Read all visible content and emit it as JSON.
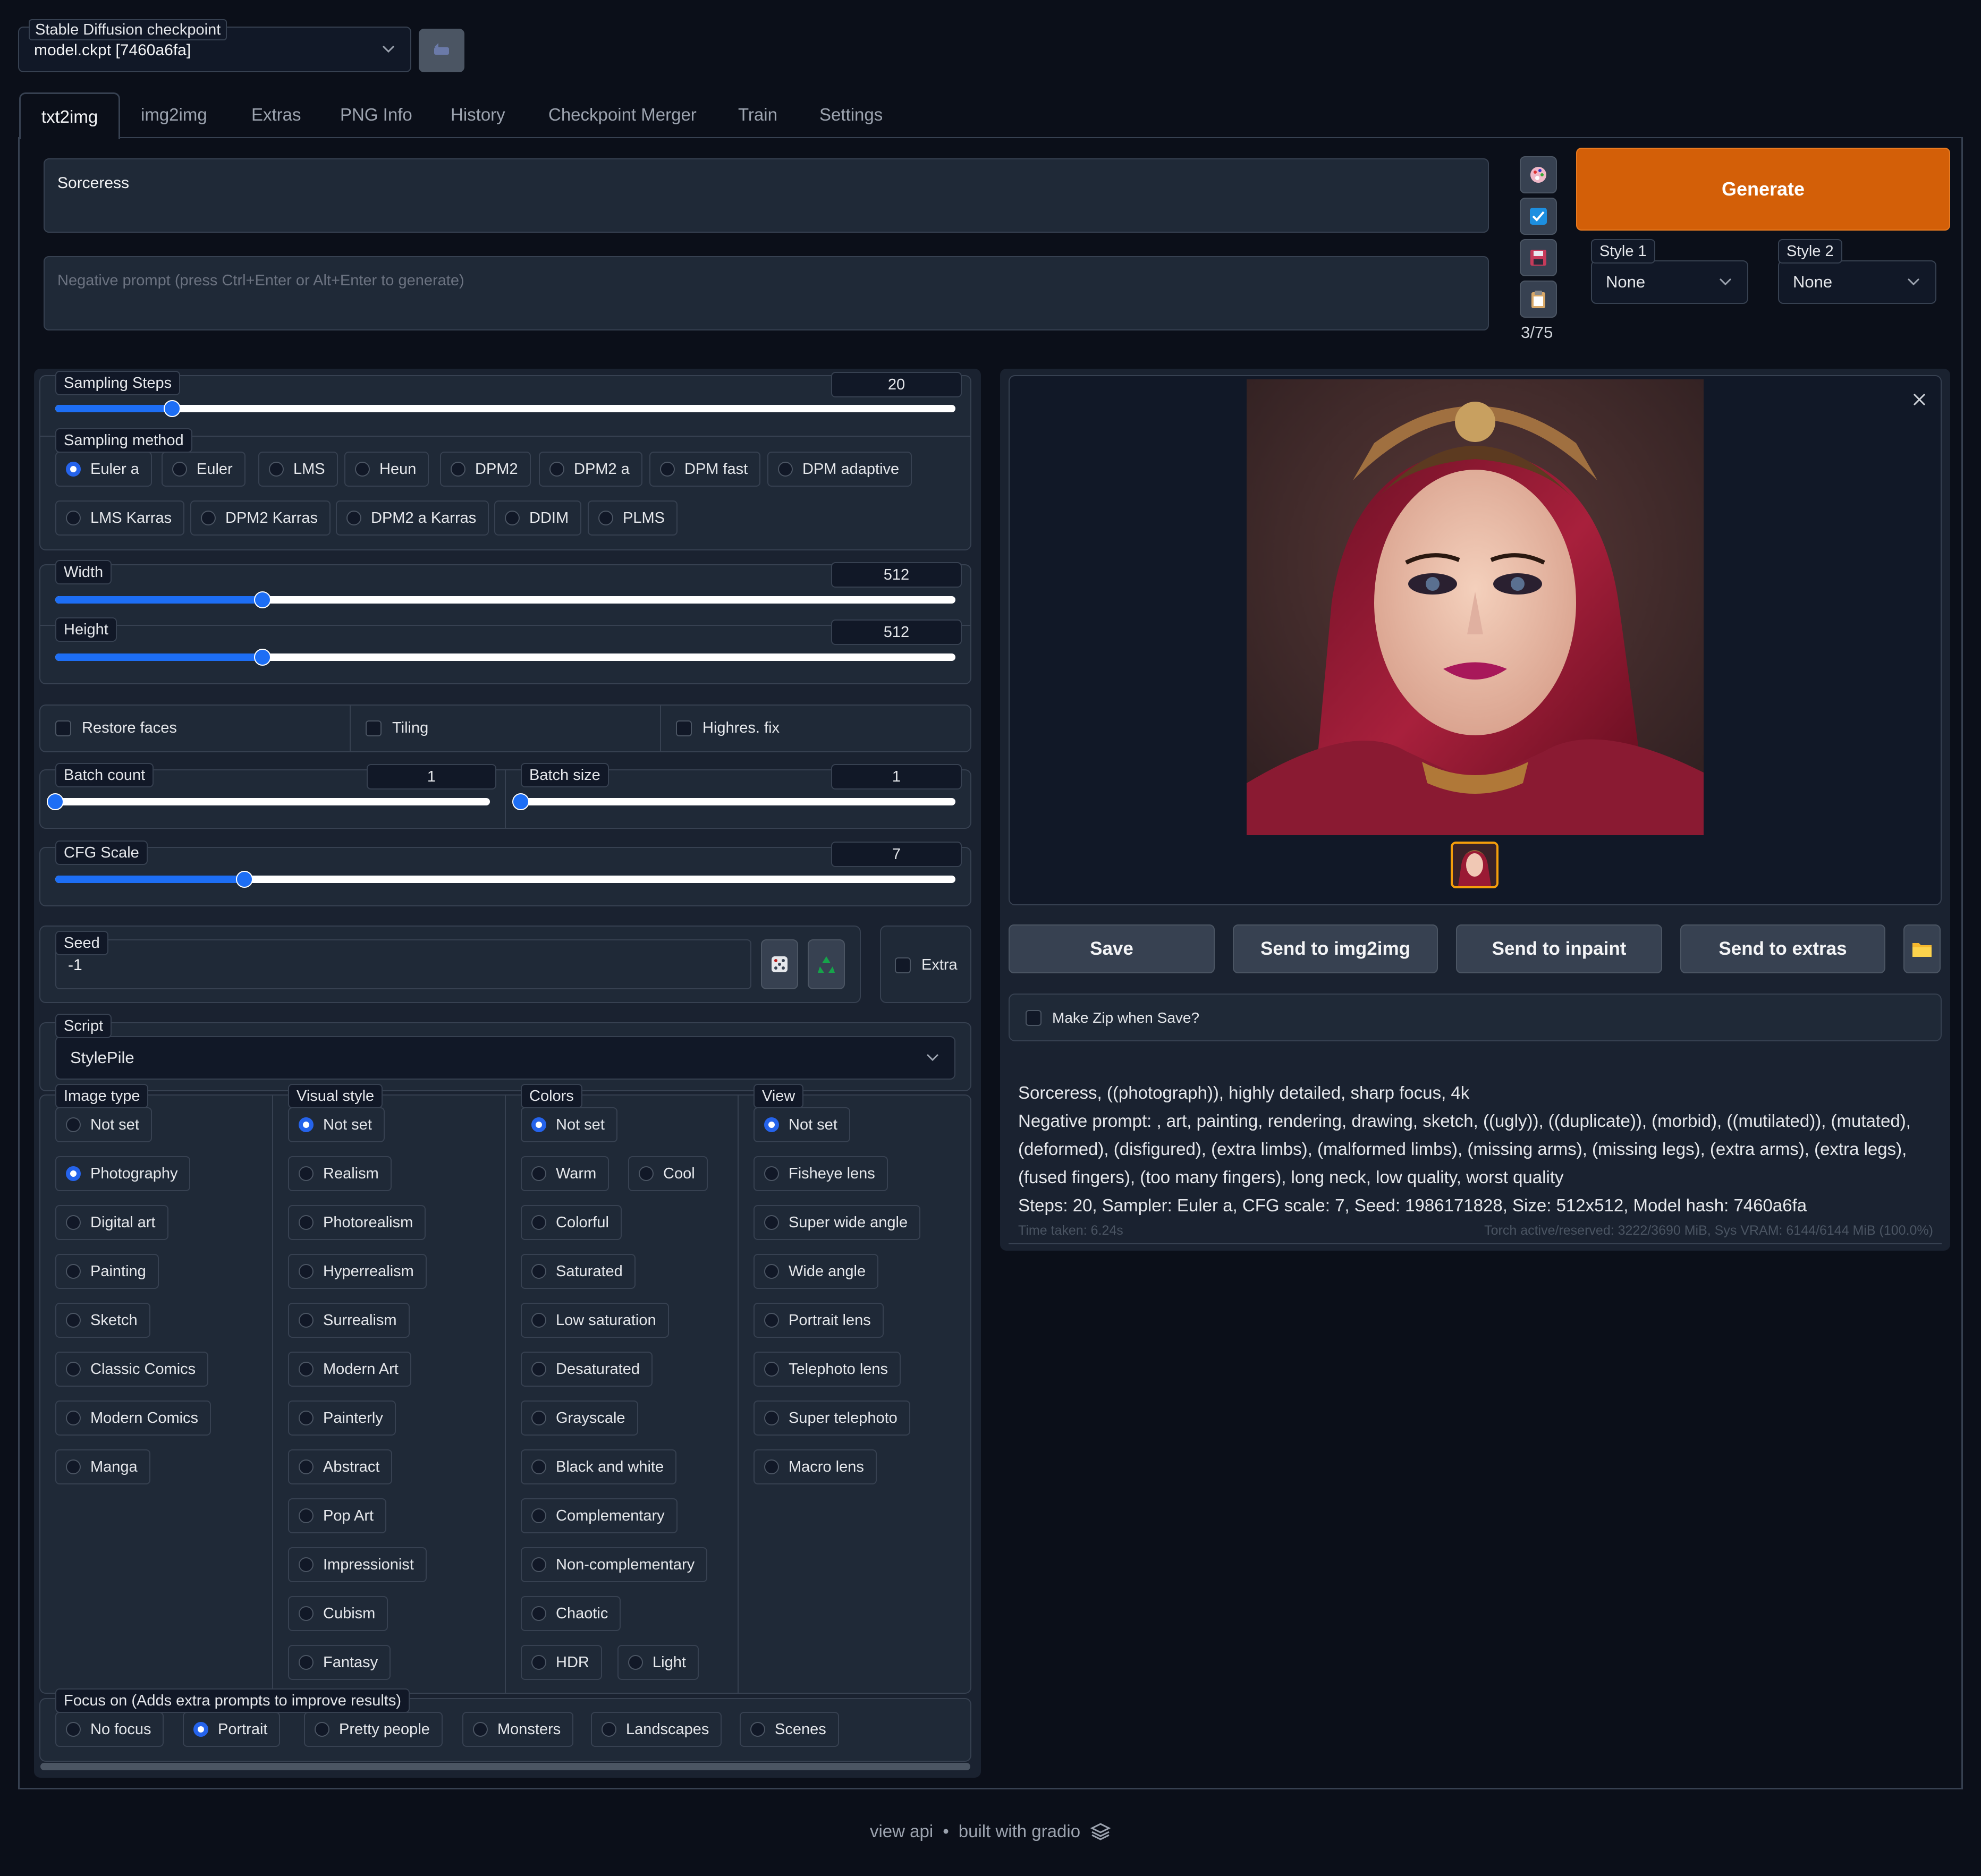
{
  "checkpoint": {
    "label": "Stable Diffusion checkpoint",
    "value": "model.ckpt [7460a6fa]"
  },
  "tabs": [
    "txt2img",
    "img2img",
    "Extras",
    "PNG Info",
    "History",
    "Checkpoint Merger",
    "Train",
    "Settings"
  ],
  "prompt": {
    "value": "Sorceress",
    "negative_placeholder": "Negative prompt (press Ctrl+Enter or Alt+Enter to generate)",
    "token_count": "3/75"
  },
  "generate": {
    "label": "Generate"
  },
  "styles": {
    "style1_label": "Style 1",
    "style1_value": "None",
    "style2_label": "Style 2",
    "style2_value": "None"
  },
  "sampling_steps": {
    "label": "Sampling Steps",
    "value": "20",
    "fraction": 0.13
  },
  "sampling_method": {
    "label": "Sampling method",
    "options": [
      "Euler a",
      "Euler",
      "LMS",
      "Heun",
      "DPM2",
      "DPM2 a",
      "DPM fast",
      "DPM adaptive",
      "LMS Karras",
      "DPM2 Karras",
      "DPM2 a Karras",
      "DDIM",
      "PLMS"
    ],
    "selected": "Euler a"
  },
  "width": {
    "label": "Width",
    "value": "512",
    "fraction": 0.23
  },
  "height": {
    "label": "Height",
    "value": "512",
    "fraction": 0.23
  },
  "options": {
    "restore_faces": "Restore faces",
    "tiling": "Tiling",
    "highres_fix": "Highres. fix"
  },
  "batch_count": {
    "label": "Batch count",
    "value": "1",
    "fraction": 0.0
  },
  "batch_size": {
    "label": "Batch size",
    "value": "1",
    "fraction": 0.0
  },
  "cfg_scale": {
    "label": "CFG Scale",
    "value": "7",
    "fraction": 0.21
  },
  "seed": {
    "label": "Seed",
    "value": "-1",
    "extra": "Extra"
  },
  "script": {
    "label": "Script",
    "value": "StylePile"
  },
  "image_type": {
    "label": "Image type",
    "options": [
      "Not set",
      "Photography",
      "Digital art",
      "Painting",
      "Sketch",
      "Classic Comics",
      "Modern Comics",
      "Manga"
    ],
    "selected": "Photography"
  },
  "visual_style": {
    "label": "Visual style",
    "options": [
      "Not set",
      "Realism",
      "Photorealism",
      "Hyperrealism",
      "Surrealism",
      "Modern Art",
      "Painterly",
      "Abstract",
      "Pop Art",
      "Impressionist",
      "Cubism",
      "Fantasy"
    ],
    "selected": "Not set"
  },
  "colors": {
    "label": "Colors",
    "options": [
      "Not set",
      "Warm",
      "Cool",
      "Colorful",
      "Saturated",
      "Low saturation",
      "Desaturated",
      "Grayscale",
      "Black and white",
      "Complementary",
      "Non-complementary",
      "Chaotic",
      "HDR",
      "Light"
    ],
    "selected": "Not set"
  },
  "view": {
    "label": "View",
    "options": [
      "Not set",
      "Fisheye lens",
      "Super wide angle",
      "Wide angle",
      "Portrait lens",
      "Telephoto lens",
      "Super telephoto",
      "Macro lens"
    ],
    "selected": "Not set"
  },
  "focus": {
    "label": "Focus on (Adds extra prompts to improve results)",
    "options": [
      "No focus",
      "Portrait",
      "Pretty people",
      "Monsters",
      "Landscapes",
      "Scenes"
    ],
    "selected": "Portrait"
  },
  "actions": {
    "save": "Save",
    "send_img2img": "Send to img2img",
    "send_inpaint": "Send to inpaint",
    "send_extras": "Send to extras"
  },
  "zip": {
    "label": "Make Zip when Save?"
  },
  "info": {
    "prompt": "Sorceress, ((photograph)), highly detailed, sharp focus, 4k",
    "negative_1": "Negative prompt: , art, painting, rendering, drawing, sketch, ((ugly)), ((duplicate)), (morbid), ((mutilated)), (mutated),",
    "negative_2": "(deformed), (disfigured), (extra limbs), (malformed limbs), (missing arms), (missing legs), (extra arms), (extra legs),",
    "negative_3": "(fused fingers), (too many fingers), long neck, low quality, worst quality",
    "params": "Steps: 20, Sampler: Euler a, CFG scale: 7, Seed: 1986171828, Size: 512x512, Model hash: 7460a6fa",
    "time": "Time taken: 6.24s",
    "vram": "Torch active/reserved: 3222/3690 MiB, Sys VRAM: 6144/6144 MiB (100.0%)"
  },
  "footer": {
    "view_api": "view api",
    "sep": "•",
    "built": "built with gradio"
  },
  "colors_theme": {
    "accent": "#1d6ef5",
    "generate": "#d35f08",
    "background": "#0b0f19",
    "panel": "#1f2937"
  },
  "icons": [
    "refresh-icon",
    "palette-icon",
    "checkbox-icon",
    "save-icon",
    "clipboard-icon",
    "dice-icon",
    "recycle-icon",
    "folder-icon",
    "close-icon",
    "chevron-down-icon",
    "gradio-logo-icon"
  ]
}
